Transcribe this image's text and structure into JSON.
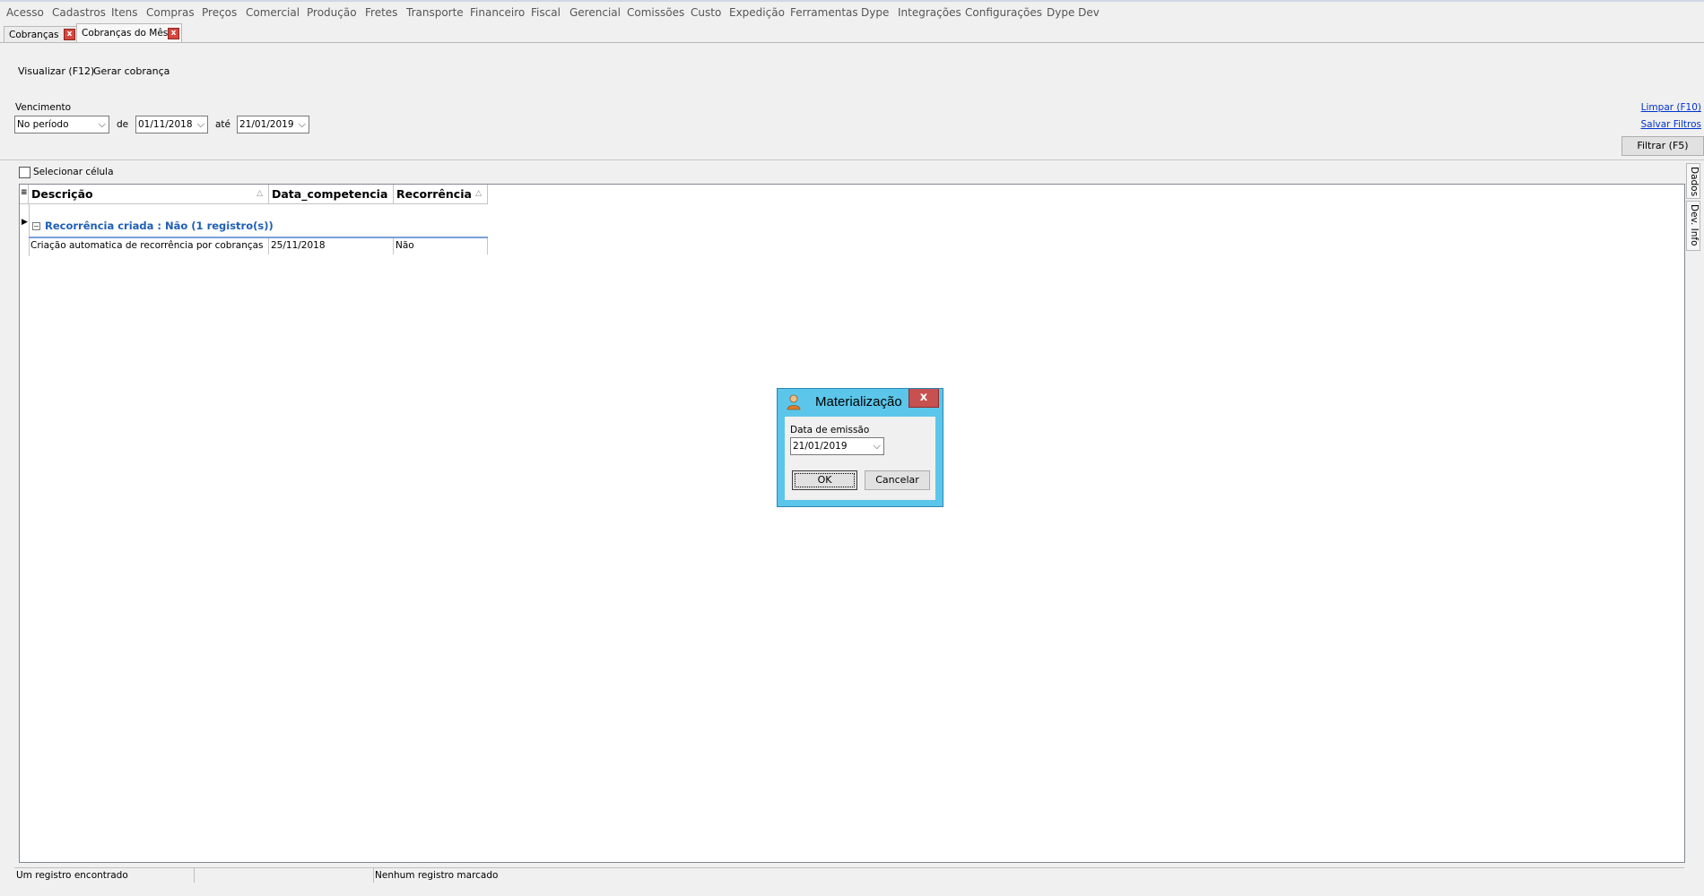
{
  "menu": [
    "Acesso",
    "Cadastros",
    "Itens",
    "Compras",
    "Preços",
    "Comercial",
    "Produção",
    "Fretes",
    "Transporte",
    "Financeiro",
    "Fiscal",
    "Gerencial",
    "Comissões",
    "Custo",
    "Expedição",
    "Ferramentas",
    "Dype",
    "Integrações",
    "Configurações",
    "Dype Dev"
  ],
  "tabs": [
    {
      "label": "Cobranças",
      "close": "x"
    },
    {
      "label": "Cobranças do Mês",
      "close": "x"
    }
  ],
  "toolbar": {
    "visualizar": "Visualizar (F12)",
    "gerar": "Gerar cobrança"
  },
  "filters": {
    "vencimento_label": "Vencimento",
    "period_value": "No período",
    "de_label": "de",
    "de_value": "01/11/2018",
    "ate_label": "até",
    "ate_value": "21/01/2019",
    "limpar": "Limpar (F10)",
    "salvar": "Salvar Filtros",
    "filtrar": "Filtrar (F5)"
  },
  "select_cell_label": "Selecionar célula",
  "grid": {
    "columns": [
      "Descrição",
      "Data_competencia",
      "Recorrência"
    ],
    "group_label": "Recorrência criada : Não (1 registro(s))",
    "rows": [
      [
        "Criação automatica de recorrência por cobranças",
        "25/11/2018",
        "Não"
      ]
    ]
  },
  "side_tabs": [
    "Dados",
    "Dev. Info"
  ],
  "status": {
    "left": "Um registro encontrado",
    "middle": "",
    "right": "Nenhum registro marcado"
  },
  "dialog": {
    "title": "Materialização",
    "close": "x",
    "date_label": "Data de emissão",
    "date_value": "21/01/2019",
    "ok": "OK",
    "cancel": "Cancelar"
  },
  "icons": {
    "dropdown": "chevron-down-icon",
    "sort": "sort-triangle-icon",
    "row_indicator": "row-pointer-icon",
    "group_collapse": "minus-box-icon",
    "app": "user-icon",
    "close": "close-icon"
  }
}
